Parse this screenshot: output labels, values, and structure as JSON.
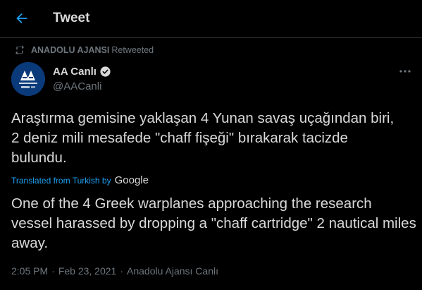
{
  "header": {
    "title": "Tweet",
    "back_icon": "arrow-left-icon"
  },
  "retweet": {
    "icon": "retweet-icon",
    "name": "ANADOLU AJANSI",
    "suffix": "Retweeted"
  },
  "author": {
    "name": "AA Canlı",
    "handle": "@AACanli",
    "verified_icon": "verified-badge-icon",
    "avatar_icon": "anadolu-ajansi-logo"
  },
  "tweet": {
    "text": "Araştırma gemisine yaklaşan 4 Yunan savaş uçağından biri, 2 deniz mili mesafede \"chaff fişeği\" bırakarak tacizde bulundu.",
    "translated_label": "Translated from Turkish by",
    "translator": "Google",
    "translated_text": "One of the 4 Greek warplanes approaching the research vessel harassed by dropping a \"chaff cartridge\" 2 nautical miles away."
  },
  "meta": {
    "time": "2:05 PM",
    "date": "Feb 23, 2021",
    "source": "Anadolu Ajansı Canlı",
    "separator": "·"
  },
  "colors": {
    "background": "#000000",
    "accent": "#1da1f2",
    "text": "#d9d9d9",
    "muted": "#6e767d"
  }
}
